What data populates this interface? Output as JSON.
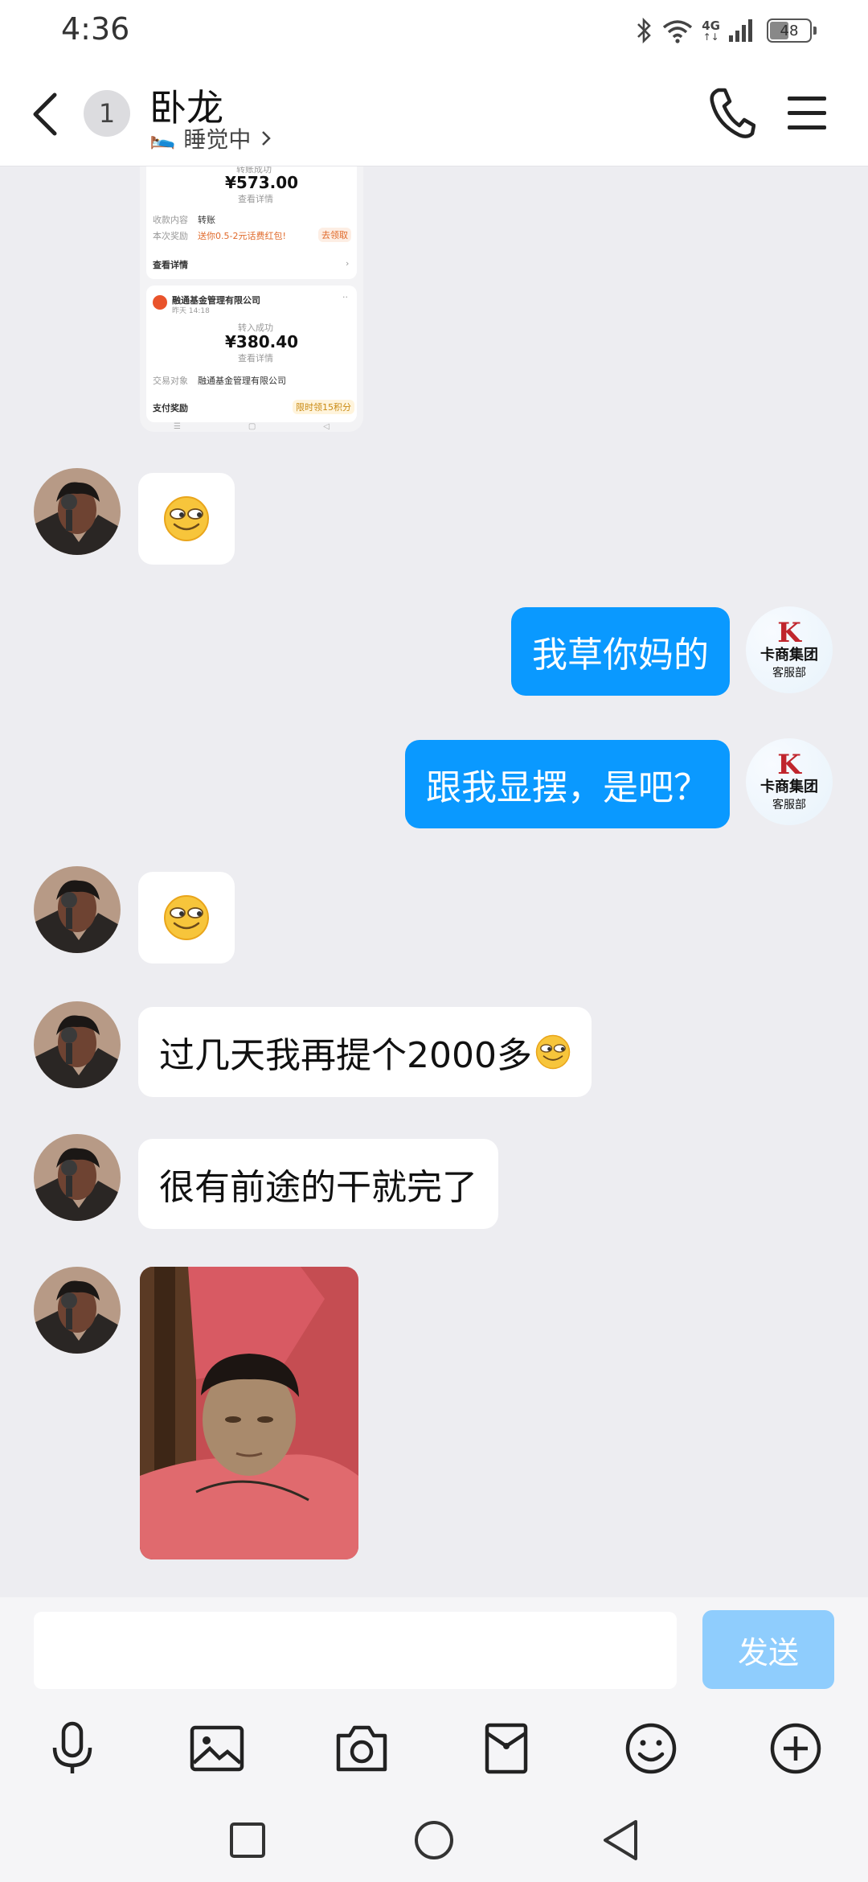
{
  "status_bar": {
    "time": "4:36",
    "network": "4G",
    "battery": "48"
  },
  "header": {
    "unread_count": "1",
    "contact_name": "卧龙",
    "status_emoji": "🛌",
    "status_text": "睡觉中"
  },
  "shared_screenshot": {
    "card1": {
      "status": "转账成功",
      "amount": "¥573.00",
      "view_detail": "查看详情",
      "row1_label": "收款内容",
      "row1_value": "转账",
      "row2_label": "本次奖励",
      "row2_value": "送你0.5-2元话费红包!",
      "row2_badge": "去领取",
      "details_link": "查看详情"
    },
    "card2": {
      "company": "融通基金管理有限公司",
      "date": "昨天 14:18",
      "status": "转入成功",
      "amount": "¥380.40",
      "view_detail": "查看详情",
      "row1_label": "交易对象",
      "row1_value": "融通基金管理有限公司",
      "row2_label": "支付奖励",
      "row2_badge": "限时领15积分"
    }
  },
  "messages": [
    {
      "side": "left",
      "type": "emoji"
    },
    {
      "side": "right",
      "text": "我草你妈的"
    },
    {
      "side": "right",
      "text": "跟我显摆，是吧？"
    },
    {
      "side": "left",
      "type": "emoji"
    },
    {
      "side": "left",
      "text": "过几天我再提个2000多"
    },
    {
      "side": "left",
      "text": "很有前途的干就完了"
    },
    {
      "side": "left",
      "type": "photo"
    }
  ],
  "right_avatar": {
    "line1": "卡商集团",
    "line2": "客服部"
  },
  "input": {
    "placeholder": "",
    "value": "",
    "send_label": "发送"
  },
  "toolbar": [
    "microphone-icon",
    "image-icon",
    "camera-icon",
    "red-packet-icon",
    "emoji-icon",
    "plus-icon"
  ],
  "colors": {
    "accent": "#0a99ff",
    "send_disabled": "#8fcdfd",
    "background": "#ededf1"
  }
}
